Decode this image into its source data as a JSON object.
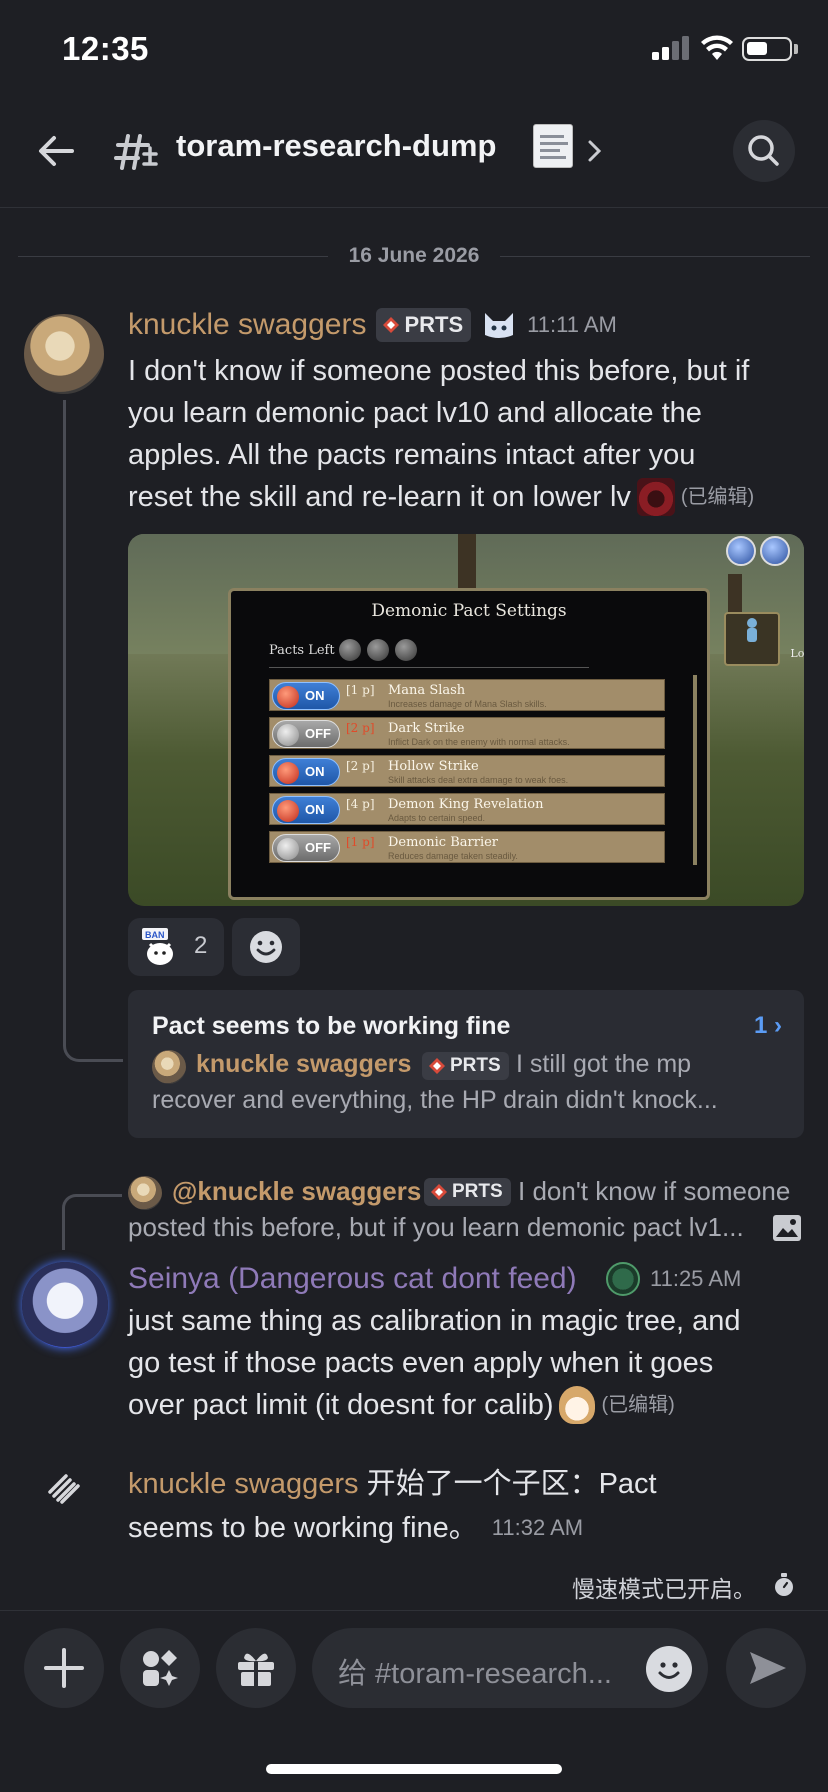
{
  "status_bar": {
    "time": "12:35"
  },
  "header": {
    "channel": "toram-research-dump"
  },
  "date_divider": "16 June 2026",
  "message1": {
    "author": "knuckle swaggers",
    "badge": "PRTS",
    "time": "11:11 AM",
    "lines": [
      "I don't know if someone posted this before, but if",
      "you learn demonic pact lv10 and allocate the",
      "apples. All the pacts remains intact after you",
      "reset the skill and re-learn it on lower lv"
    ],
    "edited": "(已编辑)",
    "image": {
      "title": "Demonic Pact Settings",
      "pacts_left_label": "Pacts Left",
      "look_label": "Look",
      "rows": [
        {
          "state": "ON",
          "cost": "[1 p]",
          "name": "Mana Slash",
          "desc": "Increases damage of Mana Slash skills.",
          "on": true
        },
        {
          "state": "OFF",
          "cost": "[2 p]",
          "name": "Dark Strike",
          "desc": "Inflict Dark on the enemy with normal attacks.",
          "on": false
        },
        {
          "state": "ON",
          "cost": "[2 p]",
          "name": "Hollow Strike",
          "desc": "Skill attacks deal extra damage to weak foes.",
          "on": true
        },
        {
          "state": "ON",
          "cost": "[4 p]",
          "name": "Demon King Revelation",
          "desc": "Adapts to certain speed.",
          "on": true
        },
        {
          "state": "OFF",
          "cost": "[1 p]",
          "name": "Demonic Barrier",
          "desc": "Reduces damage taken steadily.",
          "on": false
        }
      ]
    },
    "reaction_count": "2"
  },
  "thread": {
    "title": "Pact seems to be working fine",
    "count": "1",
    "author": "knuckle swaggers",
    "badge": "PRTS",
    "preview_line1": "I still got the mp",
    "preview_line2": "recover and everything, the HP drain didn't knock..."
  },
  "reply": {
    "author": "@knuckle swaggers",
    "badge": "PRTS",
    "line1": "I don't know if someone",
    "line2": "posted this before, but if you learn demonic pact lv1..."
  },
  "message2": {
    "author": "Seinya (Dangerous cat dont feed)",
    "time": "11:25 AM",
    "lines": [
      "just same thing as calibration in magic tree, and",
      "go test if those pacts even apply when it goes",
      "over pact limit (it doesnt for calib)"
    ],
    "edited": "(已编辑)"
  },
  "system_message": {
    "author": "knuckle swaggers",
    "text1": "开始了一个子区：Pact",
    "text2": "seems to be working fine。",
    "time": "11:32 AM"
  },
  "slowmode": "慢速模式已开启。",
  "composer": {
    "placeholder": "给 #toram-research..."
  }
}
